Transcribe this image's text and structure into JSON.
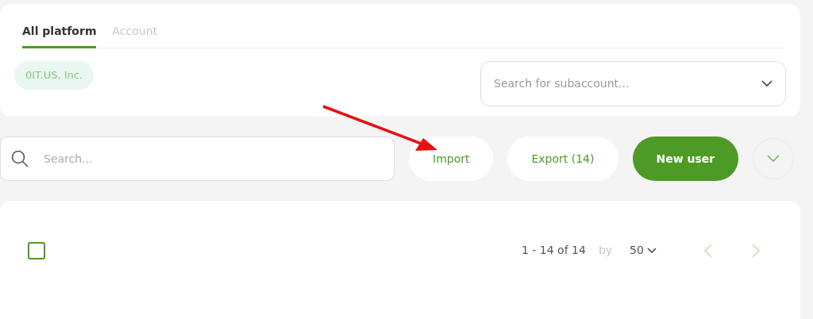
{
  "tabs": [
    {
      "label": "All platform",
      "selected": true
    },
    {
      "label": "Account",
      "selected": false
    }
  ],
  "account_chip": "0IT.US, Inc.",
  "subaccount_select": {
    "placeholder": "Search for subaccount..."
  },
  "search": {
    "placeholder": "Search..."
  },
  "buttons": [
    {
      "label": "Import",
      "kind": "outline"
    },
    {
      "label": "Export (14)",
      "kind": "outline"
    },
    {
      "label": "New user",
      "kind": "primary"
    }
  ],
  "table": {
    "select_all": {
      "checked": false
    },
    "pagination": {
      "range": "1 - 14 of 14",
      "by": "by",
      "page_size": "50",
      "prev_disabled": true,
      "next_disabled": true
    }
  }
}
